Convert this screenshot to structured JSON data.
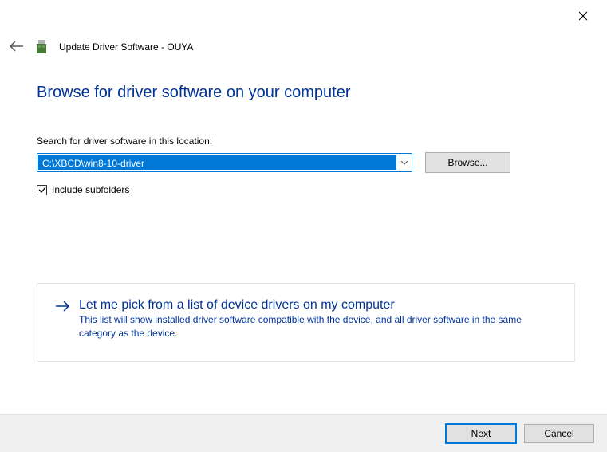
{
  "window": {
    "title": "Update Driver Software - OUYA"
  },
  "content": {
    "heading": "Browse for driver software on your computer",
    "path_label": "Search for driver software in this location:",
    "path_value": "C:\\XBCD\\win8-10-driver",
    "browse_label": "Browse...",
    "checkbox_label": "Include subfolders",
    "checkbox_checked": true
  },
  "option": {
    "title": "Let me pick from a list of device drivers on my computer",
    "description": "This list will show installed driver software compatible with the device, and all driver software in the same category as the device."
  },
  "footer": {
    "next_label": "Next",
    "cancel_label": "Cancel"
  }
}
